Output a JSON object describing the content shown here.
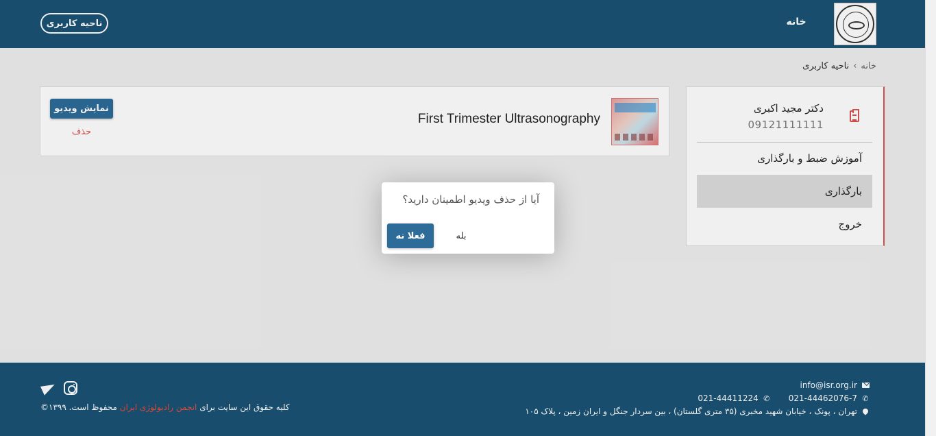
{
  "header": {
    "logo_icon": "isr-seal-logo",
    "nav_home": "خانه",
    "user_area_button": "ناحیه کاربری"
  },
  "breadcrumb": {
    "home": "خانه",
    "separator": "›",
    "current": "ناحیه کاربری"
  },
  "sidebar": {
    "profile": {
      "name": "دکتر مجید اکبری",
      "phone": "09121111111",
      "icon": "clipboard-icon"
    },
    "items": [
      {
        "label": "آموزش ضبط و بارگذاری",
        "active": false
      },
      {
        "label": "بارگذاری",
        "active": true
      },
      {
        "label": "خروج",
        "active": false
      }
    ],
    "accent_color": "#d9534f"
  },
  "video_card": {
    "title": "First Trimester Ultrasonography",
    "show_button": "نمایش ویدیو",
    "delete_link": "حذف"
  },
  "dialog": {
    "message": "آیا از حذف ویدیو اطمینان دارید؟",
    "primary_button": "فعلا نه",
    "secondary_button": "بله"
  },
  "footer": {
    "email": "info@isr.org.ir",
    "phone1": "021-44462076-7",
    "phone2": "021-44411224",
    "address": "تهران ، پونک ، خیابان شهید مخبری (۳۵ متری گلستان) ، بین سردار جنگل و ایران زمین ، پلاک ۱۰۵",
    "copyright_prefix": "کلیه حقوق این سایت برای",
    "copyright_society": "انجمن رادیولوژی ایران",
    "copyright_suffix": "محفوظ است. ۱۳۹۹©",
    "social_icons": [
      "telegram-icon",
      "instagram-icon"
    ]
  },
  "colors": {
    "header_bg": "#1a5275",
    "primary_button": "#2d6c98",
    "danger": "#d9534f"
  }
}
